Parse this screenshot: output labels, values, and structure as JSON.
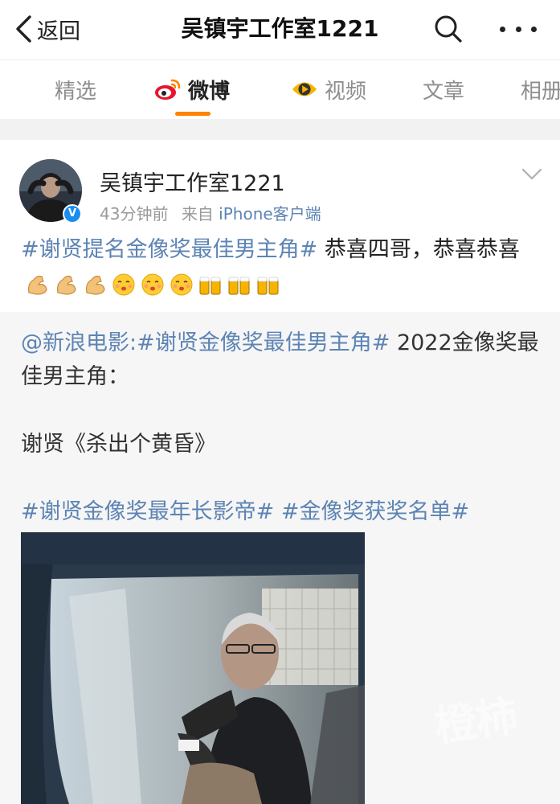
{
  "nav": {
    "back_label": "返回",
    "title": "吴镇宇工作室1221"
  },
  "tabs": [
    {
      "label": "精选",
      "active": false,
      "icon": ""
    },
    {
      "label": "微博",
      "active": true,
      "icon": "weibo-logo-icon"
    },
    {
      "label": "视频",
      "active": false,
      "icon": "video-eye-icon"
    },
    {
      "label": "文章",
      "active": false,
      "icon": ""
    },
    {
      "label": "相册",
      "active": false,
      "icon": ""
    }
  ],
  "post": {
    "author": "吴镇宇工作室1221",
    "time": "43分钟前",
    "source_prefix": "来自",
    "source": "iPhone客户端",
    "hashtag": "#谢贤提名金像奖最佳男主角#",
    "text": " 恭喜四哥，恭喜恭喜",
    "emojis": [
      "flex-icon",
      "flex-icon",
      "flex-icon",
      "kiss-icon",
      "kiss-icon",
      "kiss-icon",
      "beer-icon",
      "beer-icon",
      "beer-icon"
    ]
  },
  "repost": {
    "mention": "@新浪电影",
    "mention_sep": ":",
    "hashtag1": "#谢贤金像奖最佳男主角#",
    "line1_rest": " 2022金像奖最佳男主角：",
    "line2": "谢贤《杀出个黄昏》",
    "hashtag2": "#谢贤金像奖最年长影帝#",
    "hashtag3": "#金像奖获奖名单#"
  },
  "watermark": "橙柿"
}
